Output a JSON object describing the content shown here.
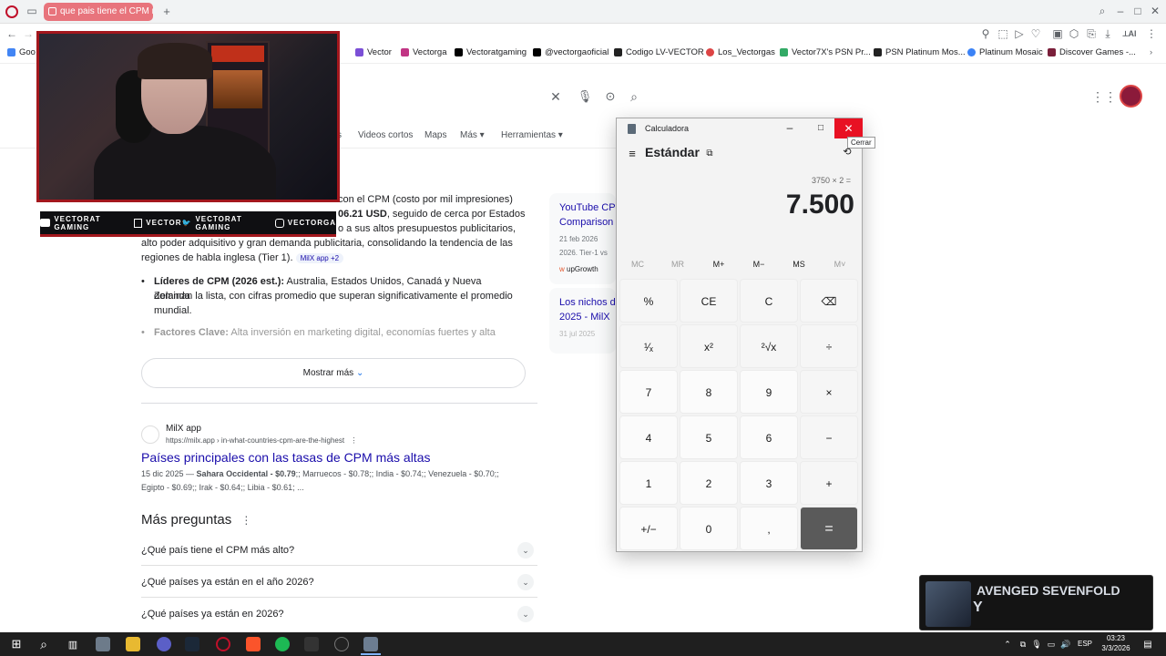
{
  "browser": {
    "tab_title": "que pais tiene el CPM mas",
    "new_tab": "+",
    "back": "←",
    "forward": "→"
  },
  "bookmarks": [
    {
      "label": "Goo",
      "color": "#4285f4"
    },
    {
      "label": "r",
      "color": "#888"
    },
    {
      "label": "Vector",
      "color": "#7b4fd6"
    },
    {
      "label": "Vectorga",
      "color": "#c13584"
    },
    {
      "label": "Vectoratgaming",
      "color": "#000000"
    },
    {
      "label": "@vectorgaoficial",
      "color": "#000000"
    },
    {
      "label": "Codigo LV-VECTOR",
      "color": "#222"
    },
    {
      "label": "Los_Vectorgas",
      "color": "#d44"
    },
    {
      "label": "Vector7X's PSN Pr...",
      "color": "#3a6"
    },
    {
      "label": "PSN Platinum Mos...",
      "color": "#222"
    },
    {
      "label": "Platinum Mosaic",
      "color": "#3b82f6"
    },
    {
      "label": "Discover Games -...",
      "color": "#7a1f3a"
    }
  ],
  "google": {
    "nav_tabs": [
      "s",
      "Videos cortos",
      "Maps",
      "Más",
      "Herramientas"
    ],
    "para_line1_tail": "con el CPM (costo por mil impresiones)",
    "para_line2_mid": "06.21 USD",
    "para_line2_tail": ", seguido de cerca por Estados",
    "para_line3_tail": "o a sus altos presupuestos publicitarios,",
    "para_line4": "alto poder adquisitivo y gran demanda publicitaria, consolidando la tendencia de las",
    "para_line5": "regiones de habla inglesa (Tier 1).",
    "source_chip": "MilX app +2",
    "bullet1_bold": "Líderes de CPM (2026 est.):",
    "bullet1_text": " Australia, Estados Unidos, Canadá y Nueva Zelanda",
    "bullet1_line2": "dominan la lista, con cifras promedio que superan significativamente el promedio",
    "bullet1_line3": "mundial.",
    "bullet2_bold": "Factores Clave:",
    "bullet2_text": " Alta inversión en marketing digital, economías fuertes y alta",
    "show_more": "Mostrar más",
    "side_card1_title1": "YouTube CPM",
    "side_card1_title2": "Comparison",
    "side_card1_date": "21 feb 2026",
    "side_card1_snippet": "2026. Tier-1 vs",
    "side_card1_source": "upGrowth",
    "side_card2_title1": "Los nichos de",
    "side_card2_title2": "2025 - MilX",
    "side_card2_date": "31 jul 2025",
    "result_site": "MilX app",
    "result_url": "https://milx.app › in-what-countries-cpm-are-the-highest",
    "result_title": "Países principales con las tasas de CPM más altas",
    "result_snippet1_date": "15 dic 2025 — ",
    "result_snippet1_bold": "Sahara Occidental - $0.79",
    "result_snippet1_rest": ";; Marruecos - $0.78;; India - $0.74;; Venezuela - $0.70;;",
    "result_snippet2": "Egipto - $0.69;; Irak - $0.64;; Libia - $0.61; ...",
    "paa_title": "Más preguntas",
    "paa_questions": [
      "¿Qué país tiene el CPM más alto?",
      "¿Qué países ya están en el año 2026?",
      "¿Qué países ya están en 2026?"
    ]
  },
  "overlay": {
    "social": [
      "VECTORAT GAMING",
      "VECTOR",
      "VECTORAT GAMING",
      "VECTORGA"
    ]
  },
  "calculator": {
    "window_title": "Calculadora",
    "mode": "Estándar",
    "expression": "3750 × 2 =",
    "result": "7.500",
    "close_tooltip": "Cerrar",
    "memory": [
      "MC",
      "MR",
      "M+",
      "M−",
      "MS",
      "M˅"
    ],
    "keys": [
      [
        "%",
        "CE",
        "C",
        "⌫"
      ],
      [
        "¹⁄ₓ",
        "x²",
        "²√x",
        "÷"
      ],
      [
        "7",
        "8",
        "9",
        "×"
      ],
      [
        "4",
        "5",
        "6",
        "−"
      ],
      [
        "1",
        "2",
        "3",
        "+"
      ],
      [
        "+/−",
        "0",
        ",",
        "="
      ]
    ]
  },
  "music": {
    "artist": "AVENGED SEVENFOLD",
    "sub": "Y"
  },
  "taskbar": {
    "lang": "ESP",
    "time": "03:23",
    "date": "3/3/2026"
  }
}
